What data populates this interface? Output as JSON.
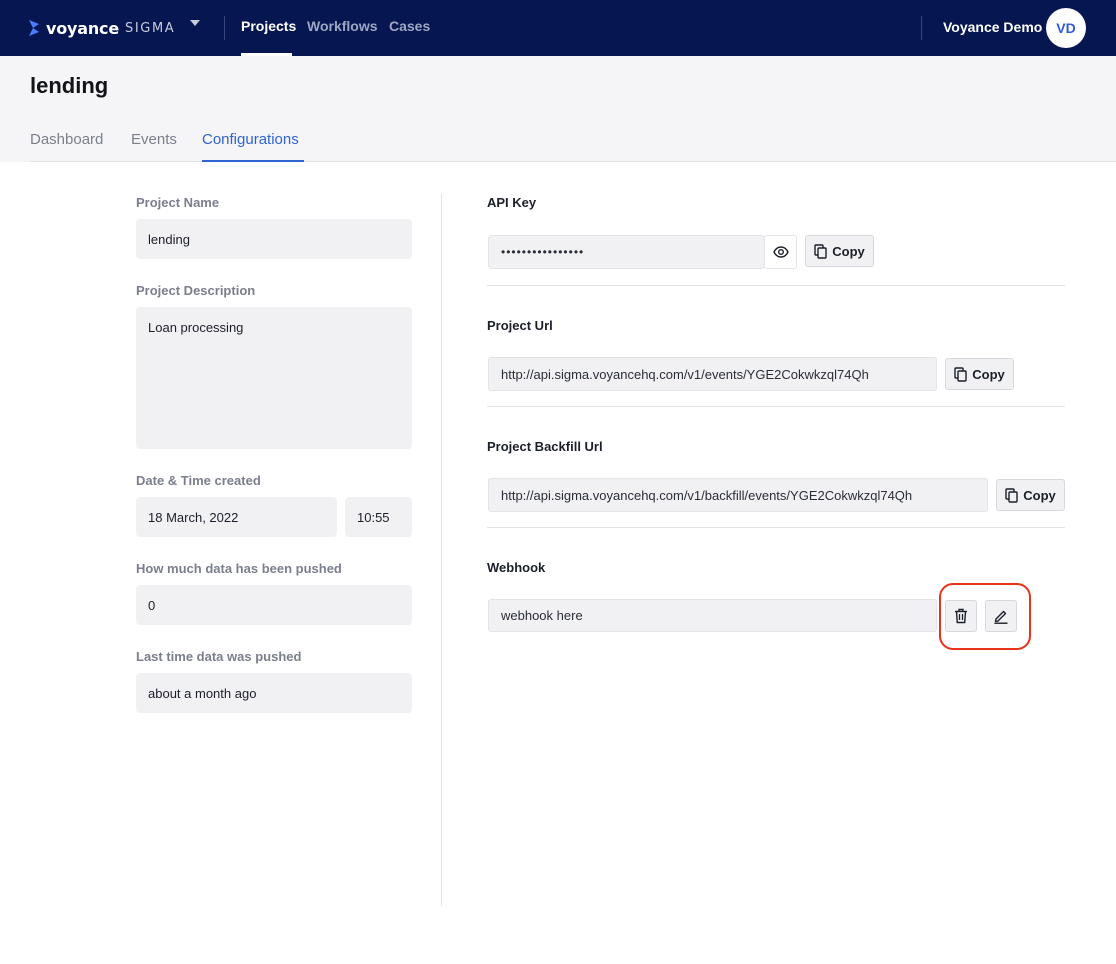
{
  "topbar": {
    "brand_name": "voyance",
    "brand_product": "SIGMA",
    "nav": [
      {
        "label": "Projects",
        "active": true
      },
      {
        "label": "Workflows",
        "active": false
      },
      {
        "label": "Cases",
        "active": false
      }
    ],
    "user_name": "Voyance Demo",
    "avatar_initials": "VD"
  },
  "page": {
    "title": "lending",
    "tabs": [
      {
        "label": "Dashboard",
        "active": false
      },
      {
        "label": "Events",
        "active": false
      },
      {
        "label": "Configurations",
        "active": true
      }
    ]
  },
  "details": {
    "project_name_label": "Project Name",
    "project_name": "lending",
    "description_label": "Project Description",
    "description": "Loan processing",
    "created_label": "Date & Time created",
    "created_date": "18 March, 2022",
    "created_time": "10:55",
    "data_pushed_label": "How much data has been pushed",
    "data_pushed": "0",
    "last_pushed_label": "Last time data was pushed",
    "last_pushed": "about a month ago"
  },
  "config": {
    "api_key_label": "API Key",
    "api_key_masked": "••••••••••••••••",
    "project_url_label": "Project Url",
    "project_url": "http://api.sigma.voyancehq.com/v1/events/YGE2Cokwkzql74Qh",
    "backfill_url_label": "Project Backfill Url",
    "backfill_url": "http://api.sigma.voyancehq.com/v1/backfill/events/YGE2Cokwkzql74Qh",
    "webhook_label": "Webhook",
    "webhook_value": "webhook here",
    "copy_label": "Copy"
  },
  "colors": {
    "navbar": "#061651",
    "accent": "#2f62d3",
    "highlight": "#e8321c"
  }
}
